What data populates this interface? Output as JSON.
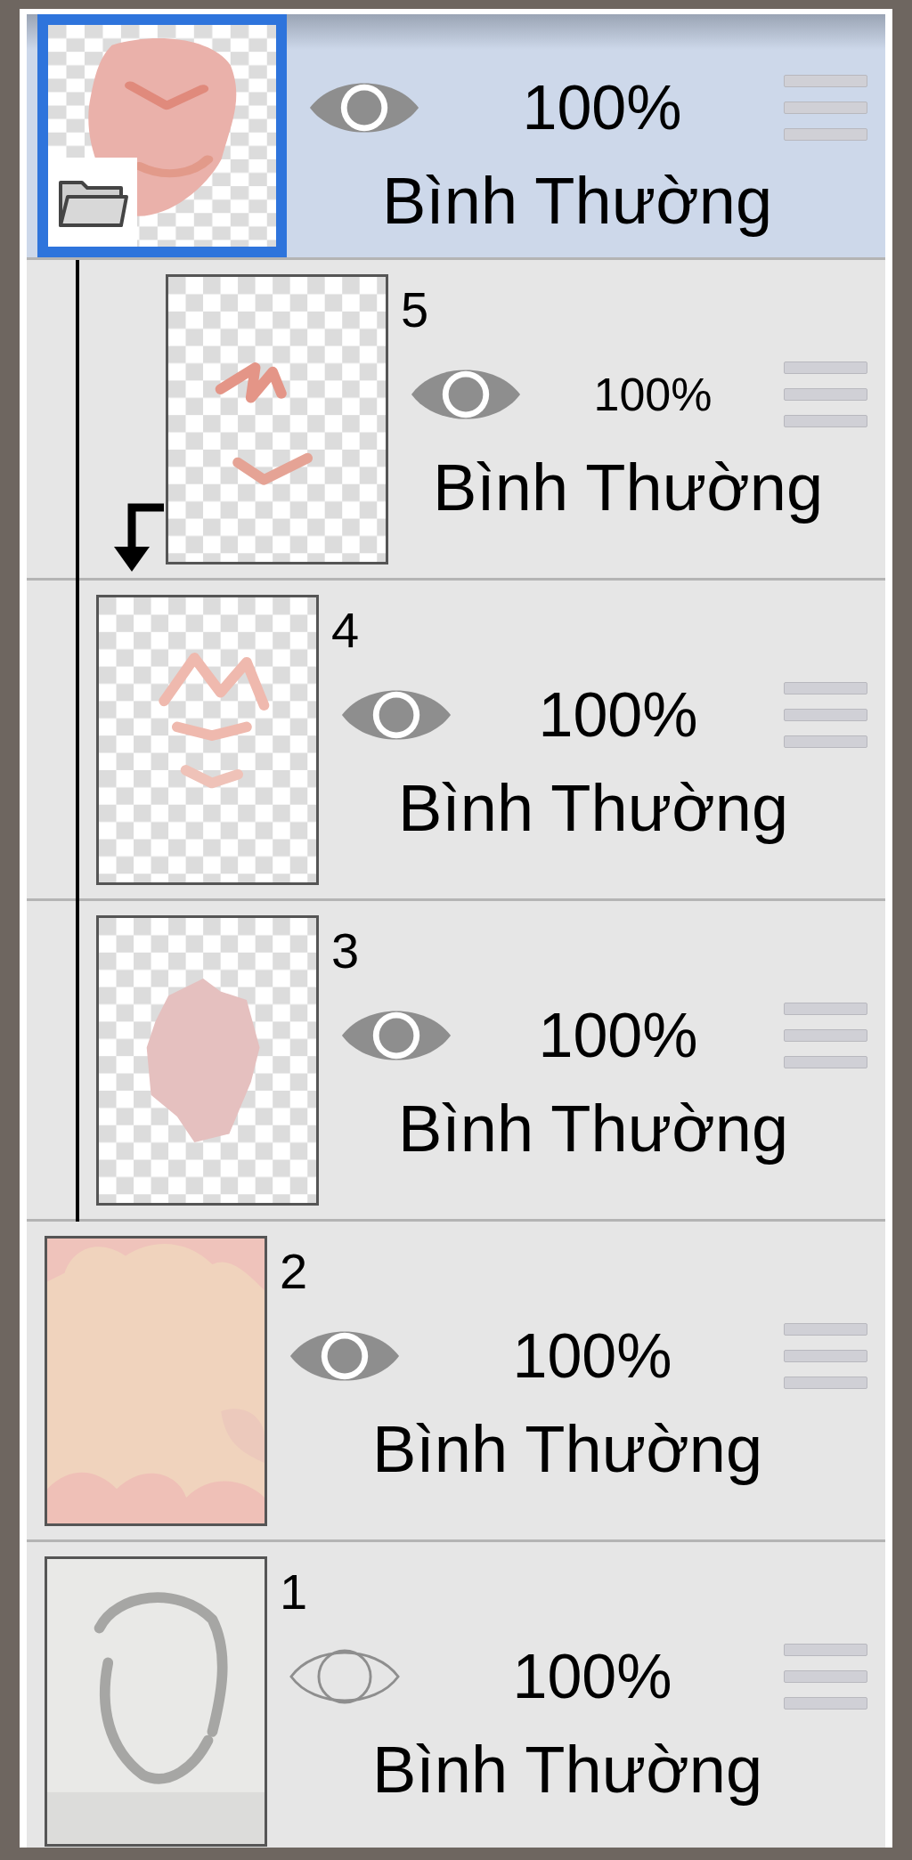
{
  "layers": [
    {
      "kind": "folder",
      "selected": true,
      "visible": true,
      "opacity": "100%",
      "blend_mode": "Bình Thường",
      "children": [
        {
          "kind": "layer",
          "number": "5",
          "selected": false,
          "visible": true,
          "clipped": true,
          "opacity": "100%",
          "blend_mode": "Bình Thường"
        },
        {
          "kind": "layer",
          "number": "4",
          "selected": false,
          "visible": true,
          "clipped": false,
          "opacity": "100%",
          "blend_mode": "Bình Thường"
        },
        {
          "kind": "layer",
          "number": "3",
          "selected": false,
          "visible": true,
          "clipped": false,
          "opacity": "100%",
          "blend_mode": "Bình Thường"
        }
      ]
    },
    {
      "kind": "layer",
      "number": "2",
      "selected": false,
      "visible": true,
      "clipped": false,
      "opacity": "100%",
      "blend_mode": "Bình Thường"
    },
    {
      "kind": "layer",
      "number": "1",
      "selected": false,
      "visible": false,
      "clipped": false,
      "opacity": "100%",
      "blend_mode": "Bình Thường"
    }
  ]
}
